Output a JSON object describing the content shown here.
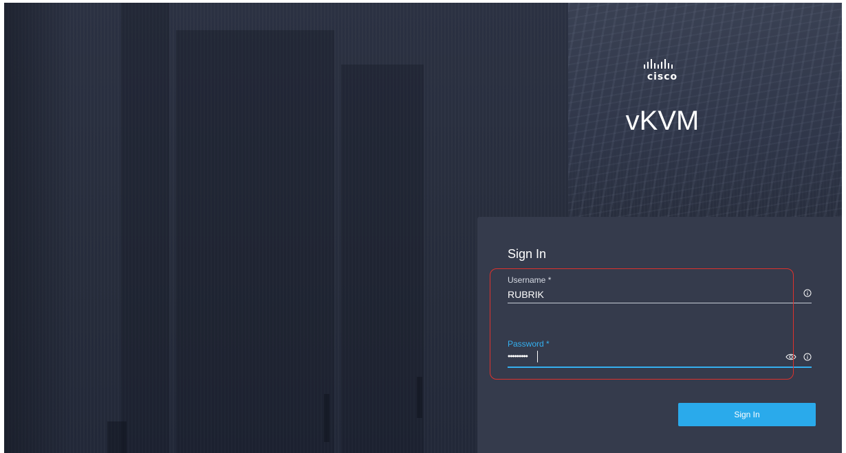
{
  "branding": {
    "logo_word": "cisco",
    "product": "vKVM"
  },
  "login": {
    "heading": "Sign In",
    "username": {
      "label": "Username *",
      "value": "RUBRIK"
    },
    "password": {
      "label": "Password *",
      "masked_value": "•••••••••"
    },
    "submit_label": "Sign In"
  },
  "icons": {
    "username_info": "info-icon",
    "password_visibility": "eye-icon",
    "password_info": "info-icon",
    "logo": "cisco-logo-icon"
  },
  "colors": {
    "background": "#262c3b",
    "card": "#353b4c",
    "accent": "#2aaaeb",
    "active_field": "#35b0f0",
    "highlight": "#e0322c"
  }
}
